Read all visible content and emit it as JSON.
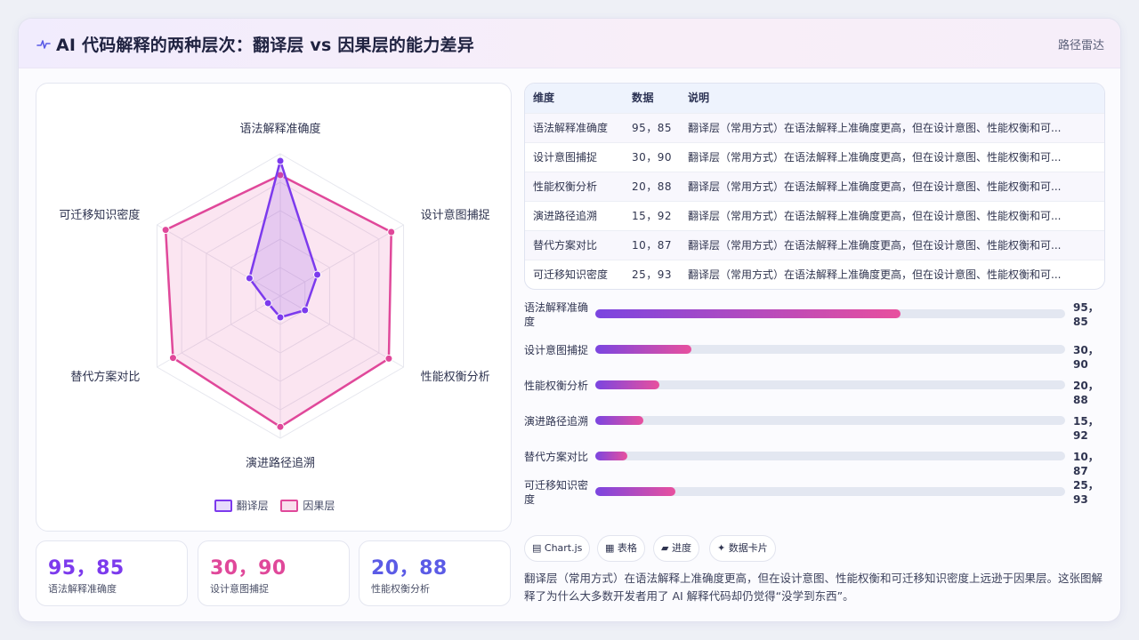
{
  "header": {
    "title": "AI 代码解释的两种层次：翻译层 vs 因果层的能力差异",
    "tag": "路径雷达"
  },
  "colors": {
    "series1": "#7c3aed",
    "series2": "#e0489a",
    "accent_blue": "#5b5be6"
  },
  "chart_data": {
    "type": "radar",
    "axes": [
      "语法解释准确度",
      "设计意图捕捉",
      "性能权衡分析",
      "演进路径追溯",
      "替代方案对比",
      "可迁移知识密度"
    ],
    "series": [
      {
        "name": "翻译层",
        "values": [
          95,
          30,
          20,
          15,
          10,
          25
        ]
      },
      {
        "name": "因果层",
        "values": [
          85,
          90,
          88,
          92,
          87,
          93
        ]
      }
    ],
    "range": [
      0,
      100
    ],
    "legend_position": "bottom"
  },
  "stats": [
    {
      "value": "95，85",
      "caption": "语法解释准确度"
    },
    {
      "value": "30，90",
      "caption": "设计意图捕捉"
    },
    {
      "value": "20，88",
      "caption": "性能权衡分析"
    }
  ],
  "table": {
    "headers": [
      "维度",
      "数据",
      "说明"
    ],
    "rows": [
      {
        "dim": "语法解释准确度",
        "data": "95，85",
        "desc": "翻译层（常用方式）在语法解释上准确度更高，但在设计意图、性能权衡和可..."
      },
      {
        "dim": "设计意图捕捉",
        "data": "30，90",
        "desc": "翻译层（常用方式）在语法解释上准确度更高，但在设计意图、性能权衡和可..."
      },
      {
        "dim": "性能权衡分析",
        "data": "20，88",
        "desc": "翻译层（常用方式）在语法解释上准确度更高，但在设计意图、性能权衡和可..."
      },
      {
        "dim": "演进路径追溯",
        "data": "15，92",
        "desc": "翻译层（常用方式）在语法解释上准确度更高，但在设计意图、性能权衡和可..."
      },
      {
        "dim": "替代方案对比",
        "data": "10，87",
        "desc": "翻译层（常用方式）在语法解释上准确度更高，但在设计意图、性能权衡和可..."
      },
      {
        "dim": "可迁移知识密度",
        "data": "25，93",
        "desc": "翻译层（常用方式）在语法解释上准确度更高，但在设计意图、性能权衡和可..."
      }
    ]
  },
  "progress": [
    {
      "label": "语法解释准确度",
      "value": "95，85",
      "fraction": 0.65
    },
    {
      "label": "设计意图捕捉",
      "value": "30，90",
      "fraction": 0.205
    },
    {
      "label": "性能权衡分析",
      "value": "20，88",
      "fraction": 0.137
    },
    {
      "label": "演进路径追溯",
      "value": "15，92",
      "fraction": 0.103
    },
    {
      "label": "替代方案对比",
      "value": "10，87",
      "fraction": 0.068
    },
    {
      "label": "可迁移知识密度",
      "value": "25，93",
      "fraction": 0.171
    }
  ],
  "chips": [
    {
      "icon": "chart-icon",
      "label": "▤ Chart.js"
    },
    {
      "icon": "table-icon",
      "label": "▦ 表格"
    },
    {
      "icon": "progress-icon",
      "label": "▰ 进度"
    },
    {
      "icon": "card-icon",
      "label": "✦ 数据卡片"
    }
  ],
  "note": "翻译层（常用方式）在语法解释上准确度更高，但在设计意图、性能权衡和可迁移知识密度上远逊于因果层。这张图解释了为什么大多数开发者用了 AI 解释代码却仍觉得“没学到东西”。"
}
